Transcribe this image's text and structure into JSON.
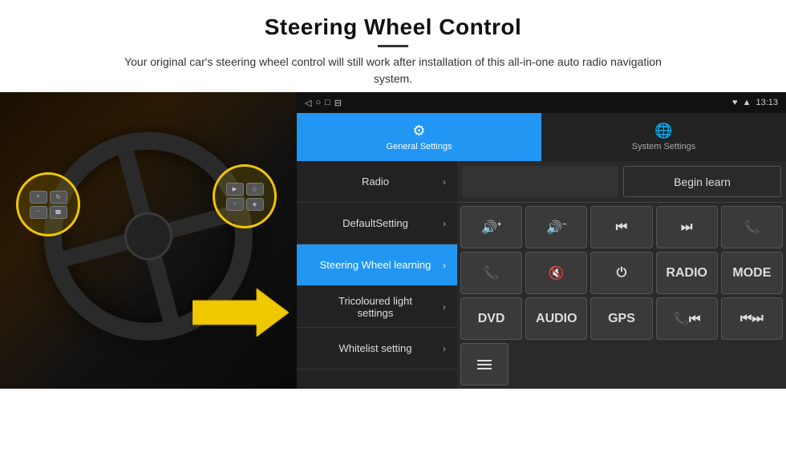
{
  "page": {
    "title": "Steering Wheel Control",
    "subtitle": "Your original car's steering wheel control will still work after installation of this all-in-one auto radio navigation system."
  },
  "tabs": [
    {
      "id": "general",
      "label": "General Settings",
      "icon": "⚙",
      "active": true
    },
    {
      "id": "system",
      "label": "System Settings",
      "icon": "🌐",
      "active": false
    }
  ],
  "status_bar": {
    "nav_icons": "◁  ○  □  ⊟",
    "right": "♥ ▲  13:13"
  },
  "menu_items": [
    {
      "label": "Radio",
      "active": false
    },
    {
      "label": "DefaultSetting",
      "active": false
    },
    {
      "label": "Steering Wheel learning",
      "active": true
    },
    {
      "label": "Tricoloured light settings",
      "active": false
    },
    {
      "label": "Whitelist setting",
      "active": false
    }
  ],
  "control_panel": {
    "begin_learn_label": "Begin learn",
    "rows": [
      [
        "🔊+",
        "🔊−",
        "⏮",
        "⏭",
        "📞"
      ],
      [
        "📞",
        "🔇",
        "⏻",
        "RADIO",
        "MODE"
      ],
      [
        "DVD",
        "AUDIO",
        "GPS",
        "📞⏮",
        "⏮⏭"
      ]
    ],
    "bottom_icon": "≡"
  }
}
